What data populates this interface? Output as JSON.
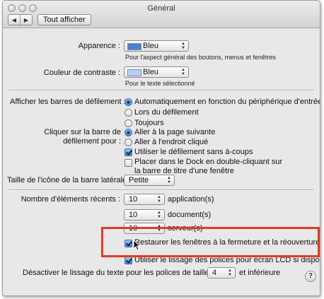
{
  "window": {
    "title": "Général"
  },
  "toolbar": {
    "back_symbol": "◀",
    "forward_symbol": "▶",
    "show_all": "Tout afficher"
  },
  "appearance": {
    "label": "Apparence :",
    "value": "Bleu",
    "note": "Pour l'aspect général des boutons, menus et fenêtres",
    "swatch_color": "#4f7fcf"
  },
  "highlight": {
    "label": "Couleur de contraste :",
    "value": "Bleu",
    "note": "Pour le texte sélectionné",
    "swatch_color": "#b7cff3"
  },
  "scrollbars": {
    "label": "Afficher les barres de défilement :",
    "options": [
      "Automatiquement en fonction du périphérique d'entrée",
      "Lors du défilement",
      "Toujours"
    ],
    "selected_index": 0
  },
  "scroll_click": {
    "label_line1": "Cliquer sur la barre de",
    "label_line2": "défilement pour :",
    "options": [
      "Aller à la page suivante",
      "Aller à l'endroit cliqué"
    ],
    "selected_index": 0
  },
  "smooth_scroll": {
    "label": "Utiliser le défilement sans à-coups",
    "checked": true
  },
  "dock_double_click": {
    "line1": "Placer dans le Dock en double-cliquant sur",
    "line2": "la barre de titre d'une fenêtre",
    "checked": false
  },
  "sidebar_icon": {
    "label": "Taille de l'icône de la barre latérale :",
    "value": "Petite"
  },
  "recent_items": {
    "label": "Nombre d'éléments récents :",
    "rows": [
      {
        "value": "10",
        "unit": "application(s)"
      },
      {
        "value": "10",
        "unit": "document(s)"
      },
      {
        "value": "10",
        "unit": "serveur(s)"
      }
    ]
  },
  "restore_windows": {
    "label": "Restaurer les fenêtres à la fermeture et la réouverture d'apps",
    "checked": true
  },
  "lcd_smoothing": {
    "label": "Utiliser le lissage des polices pour écran LCD si disponible",
    "checked": true
  },
  "font_smoothing": {
    "label_prefix": "Désactiver le lissage du texte pour les polices de taille",
    "value": "4",
    "label_suffix": "et inférieure"
  },
  "help": {
    "symbol": "?"
  },
  "icons": {
    "popup_arrows": "▲▼",
    "cursor": "arrow-pointer"
  },
  "colors": {
    "annotation_red": "#e23a2a",
    "selection_blue": "#4a86d8"
  }
}
